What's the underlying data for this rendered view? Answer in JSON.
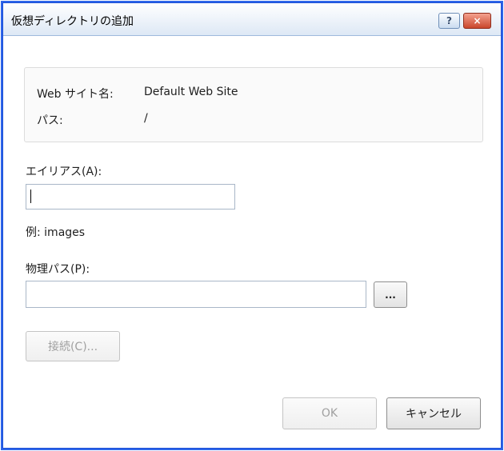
{
  "window": {
    "title": "仮想ディレクトリの追加",
    "help_icon": "?",
    "close_icon": "×"
  },
  "info": {
    "site_label": "Web サイト名:",
    "site_value": "Default Web Site",
    "path_label": "パス:",
    "path_value": "/"
  },
  "alias": {
    "label": "エイリアス(A):",
    "value": "",
    "example": "例: images"
  },
  "physical_path": {
    "label": "物理パス(P):",
    "value": "",
    "browse_label": "..."
  },
  "buttons": {
    "connect_label": "接続(C)...",
    "ok_label": "OK",
    "cancel_label": "キャンセル"
  }
}
